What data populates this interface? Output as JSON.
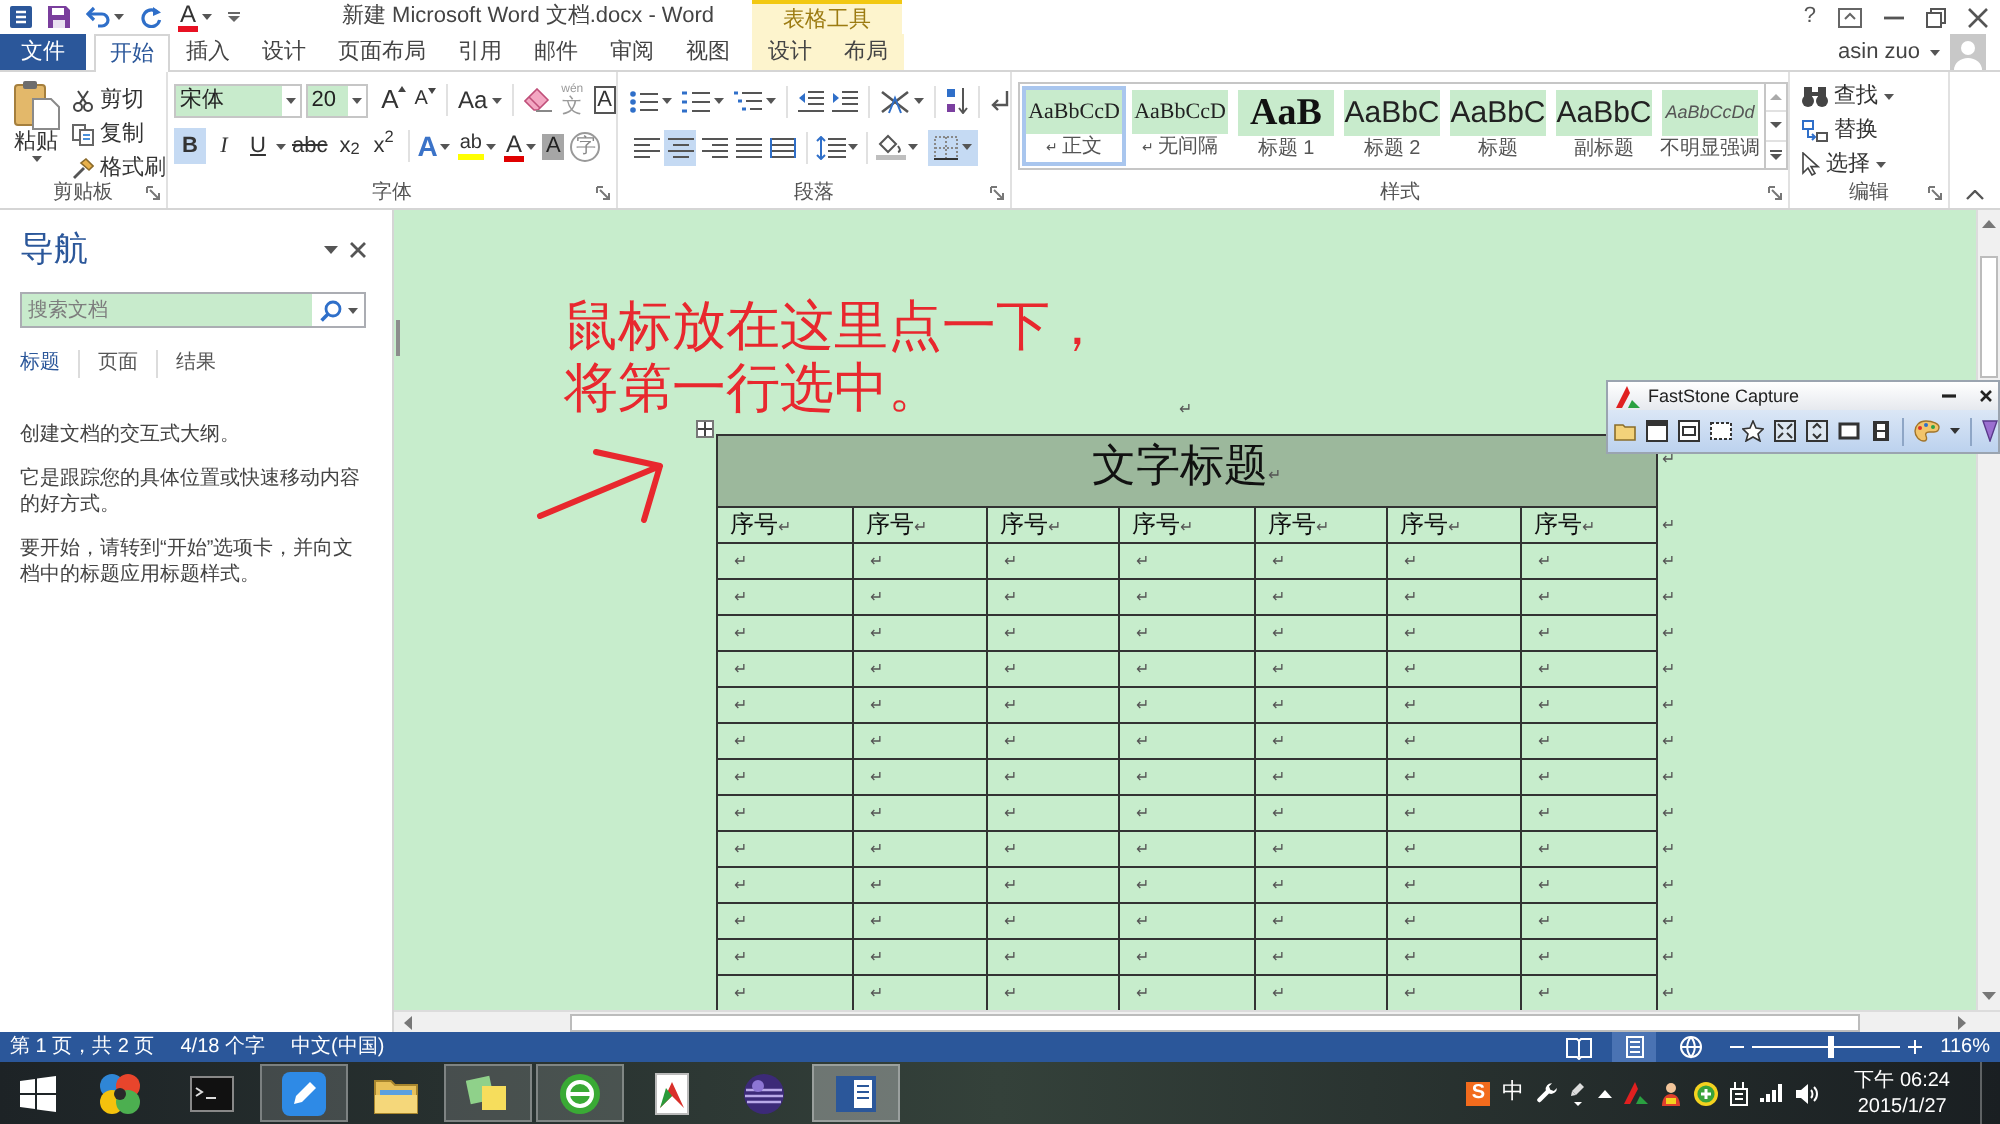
{
  "quick_access": {
    "font_color": "A"
  },
  "title_bar": {
    "title": "新建 Microsoft Word 文档.docx - Word",
    "help": "?"
  },
  "contextual_group": {
    "label": "表格工具"
  },
  "tabs": [
    {
      "label": "文件",
      "kind": "file",
      "selected": false
    },
    {
      "label": "开始",
      "kind": "normal",
      "selected": true
    },
    {
      "label": "插入",
      "kind": "normal",
      "selected": false
    },
    {
      "label": "设计",
      "kind": "normal",
      "selected": false
    },
    {
      "label": "页面布局",
      "kind": "normal",
      "selected": false
    },
    {
      "label": "引用",
      "kind": "normal",
      "selected": false
    },
    {
      "label": "邮件",
      "kind": "normal",
      "selected": false
    },
    {
      "label": "审阅",
      "kind": "normal",
      "selected": false
    },
    {
      "label": "视图",
      "kind": "normal",
      "selected": false
    },
    {
      "label": "设计",
      "kind": "contextual",
      "selected": false
    },
    {
      "label": "布局",
      "kind": "contextual",
      "selected": false
    }
  ],
  "account": {
    "name": "asin zuo"
  },
  "ribbon": {
    "clipboard": {
      "label": "剪贴板",
      "paste": "粘贴",
      "commands": [
        "剪切",
        "复制",
        "格式刷"
      ]
    },
    "font": {
      "label": "字体",
      "font_name": "宋体",
      "font_size": "20",
      "grow": "A",
      "shrink": "A",
      "change_case": "Aa",
      "phonetic": {
        "ruby": "wén",
        "base": "文"
      },
      "char_border": "A",
      "toggles": [
        {
          "glyph": "B",
          "kind": "bold",
          "on": true
        },
        {
          "glyph": "I",
          "kind": "italic",
          "on": false
        },
        {
          "glyph": "U",
          "kind": "underline",
          "on": false
        },
        {
          "glyph": "abc",
          "kind": "strike",
          "on": false
        },
        {
          "glyph": "x$_{2}$",
          "kind": "subscript",
          "on": false
        },
        {
          "glyph": "x$^{2}$",
          "kind": "superscript",
          "on": false
        }
      ],
      "text_effects": "A",
      "highlight": "ab",
      "font_color": "A",
      "char_shading": "A",
      "enclosed": "字"
    },
    "paragraph": {
      "label": "段落",
      "alignment": [
        {
          "selected": false
        },
        {
          "selected": true
        },
        {
          "selected": false
        },
        {
          "selected": false
        },
        {
          "selected": false
        }
      ],
      "borders": {
        "on": true
      }
    },
    "styles": {
      "label": "样式",
      "items": [
        {
          "preview": "AaBbCcD",
          "label": "正文",
          "mark": "↵",
          "kind": "normal",
          "selected": true
        },
        {
          "preview": "AaBbCcD",
          "label": "无间隔",
          "mark": "↵",
          "kind": "normal",
          "selected": false
        },
        {
          "preview": "AaB",
          "label": "标题 1",
          "kind": "heading1",
          "selected": false
        },
        {
          "preview": "AaBbC",
          "label": "标题 2",
          "kind": "heading2",
          "selected": false
        },
        {
          "preview": "AaBbC",
          "label": "标题",
          "kind": "title",
          "selected": false
        },
        {
          "preview": "AaBbC",
          "label": "副标题",
          "kind": "subtitle",
          "selected": false
        },
        {
          "preview": "AaBbCcDd",
          "label": "不明显强调",
          "kind": "emphasis",
          "selected": false
        }
      ]
    },
    "editing": {
      "label": "编辑",
      "commands": [
        {
          "label": "查找",
          "dropdown": true
        },
        {
          "label": "替换",
          "dropdown": false
        },
        {
          "label": "选择",
          "dropdown": true
        }
      ]
    }
  },
  "navigation": {
    "title": "导航",
    "search": {
      "placeholder": "搜索文档"
    },
    "tabs": [
      {
        "label": "标题",
        "selected": true
      },
      {
        "label": "页面",
        "selected": false
      },
      {
        "label": "结果",
        "selected": false
      }
    ],
    "paragraphs": [
      "创建文档的交互式大纲。",
      "它是跟踪您的具体位置或快速移动内容的好方式。",
      "要开始，请转到“开始”选项卡，并向文档中的标题应用标题样式。"
    ]
  },
  "document": {
    "annotation": "鼠标放在这里点一下，将第一行选中。",
    "empty_paragraph": "↵",
    "table": {
      "title": "文字标题",
      "title_mark": "↵",
      "title_end": "↵",
      "header": [
        {
          "text": "序号",
          "mark": "↵"
        },
        {
          "text": "序号",
          "mark": "↵"
        },
        {
          "text": "序号",
          "mark": "↵"
        },
        {
          "text": "序号",
          "mark": "↵"
        },
        {
          "text": "序号",
          "mark": "↵"
        },
        {
          "text": "序号",
          "mark": "↵"
        },
        {
          "text": "序号",
          "mark": "↵"
        }
      ],
      "header_end": "↵",
      "rows": [
        {
          "cells": [
            "↵",
            "↵",
            "↵",
            "↵",
            "↵",
            "↵",
            "↵"
          ],
          "end": "↵"
        },
        {
          "cells": [
            "↵",
            "↵",
            "↵",
            "↵",
            "↵",
            "↵",
            "↵"
          ],
          "end": "↵"
        },
        {
          "cells": [
            "↵",
            "↵",
            "↵",
            "↵",
            "↵",
            "↵",
            "↵"
          ],
          "end": "↵"
        },
        {
          "cells": [
            "↵",
            "↵",
            "↵",
            "↵",
            "↵",
            "↵",
            "↵"
          ],
          "end": "↵"
        },
        {
          "cells": [
            "↵",
            "↵",
            "↵",
            "↵",
            "↵",
            "↵",
            "↵"
          ],
          "end": "↵"
        },
        {
          "cells": [
            "↵",
            "↵",
            "↵",
            "↵",
            "↵",
            "↵",
            "↵"
          ],
          "end": "↵"
        },
        {
          "cells": [
            "↵",
            "↵",
            "↵",
            "↵",
            "↵",
            "↵",
            "↵"
          ],
          "end": "↵"
        },
        {
          "cells": [
            "↵",
            "↵",
            "↵",
            "↵",
            "↵",
            "↵",
            "↵"
          ],
          "end": "↵"
        },
        {
          "cells": [
            "↵",
            "↵",
            "↵",
            "↵",
            "↵",
            "↵",
            "↵"
          ],
          "end": "↵"
        },
        {
          "cells": [
            "↵",
            "↵",
            "↵",
            "↵",
            "↵",
            "↵",
            "↵"
          ],
          "end": "↵"
        },
        {
          "cells": [
            "↵",
            "↵",
            "↵",
            "↵",
            "↵",
            "↵",
            "↵"
          ],
          "end": "↵"
        },
        {
          "cells": [
            "↵",
            "↵",
            "↵",
            "↵",
            "↵",
            "↵",
            "↵"
          ],
          "end": "↵"
        },
        {
          "cells": [
            "↵",
            "↵",
            "↵",
            "↵",
            "↵",
            "↵",
            "↵"
          ],
          "end": "↵"
        }
      ]
    }
  },
  "capture_toolbar": {
    "title": "FastStone Capture"
  },
  "status_bar": {
    "page": "第 1 页，共 2 页",
    "words": "4/18 个字",
    "language": "中文(中国)",
    "views": [
      {
        "selected": false
      },
      {
        "selected": true
      },
      {
        "selected": false
      }
    ],
    "zoom_slider": {
      "level": 0.52
    },
    "zoom": "116%"
  },
  "taskbar": {
    "apps": [
      {
        "open": false,
        "selected": false
      },
      {
        "open": false,
        "selected": false
      },
      {
        "open": true,
        "selected": false
      },
      {
        "open": false,
        "selected": false
      },
      {
        "open": true,
        "selected": false
      },
      {
        "open": true,
        "selected": false
      },
      {
        "open": false,
        "selected": false
      },
      {
        "open": false,
        "selected": false
      },
      {
        "open": true,
        "selected": true
      }
    ],
    "tray_badge": "S",
    "tray_text": "中",
    "time": "下午 06:24",
    "date": "2015/1/27"
  }
}
